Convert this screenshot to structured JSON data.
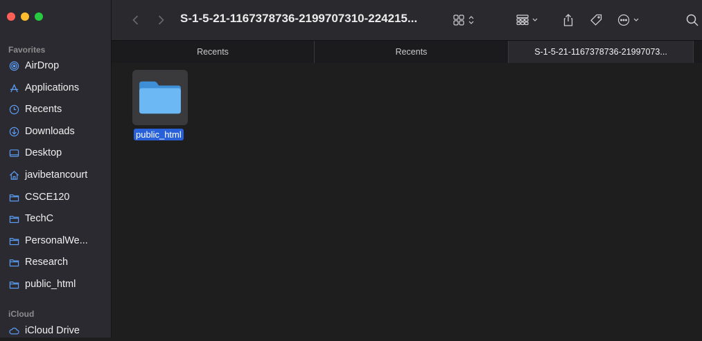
{
  "window": {
    "title": "S-1-5-21-1167378736-2199707310-224215..."
  },
  "sidebar": {
    "favorites_label": "Favorites",
    "items": [
      {
        "label": "AirDrop",
        "icon": "airdrop-icon"
      },
      {
        "label": "Applications",
        "icon": "applications-icon"
      },
      {
        "label": "Recents",
        "icon": "clock-icon"
      },
      {
        "label": "Downloads",
        "icon": "download-icon"
      },
      {
        "label": "Desktop",
        "icon": "desktop-icon"
      },
      {
        "label": "javibetancourt",
        "icon": "home-icon"
      },
      {
        "label": "CSCE120",
        "icon": "folder-icon"
      },
      {
        "label": "TechC",
        "icon": "folder-icon"
      },
      {
        "label": "PersonalWe...",
        "icon": "folder-icon"
      },
      {
        "label": "Research",
        "icon": "folder-icon"
      },
      {
        "label": "public_html",
        "icon": "folder-icon"
      }
    ],
    "icloud_label": "iCloud",
    "icloud_items": [
      {
        "label": "iCloud Drive",
        "icon": "cloud-icon"
      }
    ]
  },
  "tabs": [
    {
      "label": "Recents",
      "active": false
    },
    {
      "label": "Recents",
      "active": false
    },
    {
      "label": "S-1-5-21-1167378736-21997073...",
      "active": true
    }
  ],
  "content": {
    "items": [
      {
        "name": "public_html",
        "selected": true
      }
    ]
  },
  "colors": {
    "sidebar_bg": "#2b2a30",
    "accent": "#2760d8",
    "folder_blue": "#5aaaf0"
  }
}
